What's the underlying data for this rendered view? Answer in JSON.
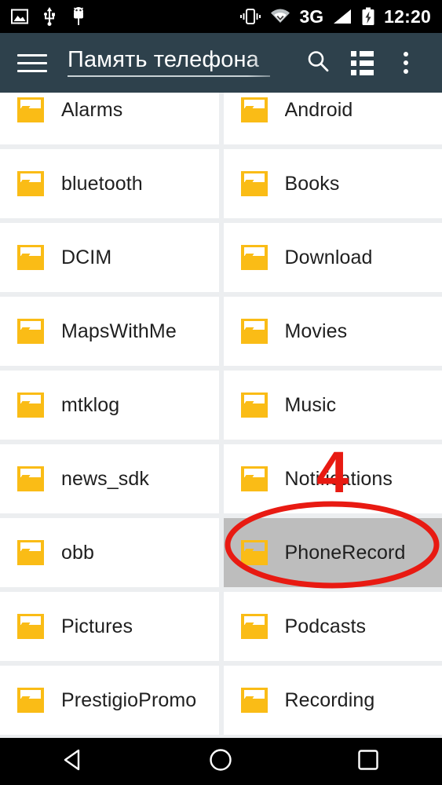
{
  "statusbar": {
    "left_icons": [
      "image-icon",
      "usb-icon",
      "android-debug-icon"
    ],
    "vibrate_icon": "vibrate-icon",
    "wifi_icon": "wifi-icon",
    "network_label": "3G",
    "signal_icon": "signal-bars-icon",
    "battery_icon": "battery-charging-icon",
    "clock": "12:20",
    "background_color": "#000000"
  },
  "appbar": {
    "menu_icon": "hamburger-menu-icon",
    "title": "Память телефона",
    "search_icon": "search-icon",
    "list_view_icon": "list-view-icon",
    "overflow_icon": "overflow-menu-icon",
    "background_color": "#2e414c"
  },
  "grid": {
    "folder_color": "#fabc16",
    "selected_color": "#bdbdbd",
    "rows": [
      {
        "left": {
          "name": "Alarms",
          "selected": false
        },
        "right": {
          "name": "Android",
          "selected": false
        }
      },
      {
        "left": {
          "name": "bluetooth",
          "selected": false
        },
        "right": {
          "name": "Books",
          "selected": false
        }
      },
      {
        "left": {
          "name": "DCIM",
          "selected": false
        },
        "right": {
          "name": "Download",
          "selected": false
        }
      },
      {
        "left": {
          "name": "MapsWithMe",
          "selected": false
        },
        "right": {
          "name": "Movies",
          "selected": false
        }
      },
      {
        "left": {
          "name": "mtklog",
          "selected": false
        },
        "right": {
          "name": "Music",
          "selected": false
        }
      },
      {
        "left": {
          "name": "news_sdk",
          "selected": false
        },
        "right": {
          "name": "Notifications",
          "selected": false
        }
      },
      {
        "left": {
          "name": "obb",
          "selected": false
        },
        "right": {
          "name": "PhoneRecord",
          "selected": true
        }
      },
      {
        "left": {
          "name": "Pictures",
          "selected": false
        },
        "right": {
          "name": "Podcasts",
          "selected": false
        }
      },
      {
        "left": {
          "name": "PrestigioPromo",
          "selected": false
        },
        "right": {
          "name": "Recording",
          "selected": false
        }
      }
    ]
  },
  "annotation": {
    "step_number": "4",
    "color": "#e81a12",
    "highlight_shape": "ellipse-around-phonerecord"
  },
  "navbar": {
    "back_icon": "back-triangle-icon",
    "home_icon": "home-circle-icon",
    "recents_icon": "recents-square-icon",
    "background_color": "#000000"
  }
}
